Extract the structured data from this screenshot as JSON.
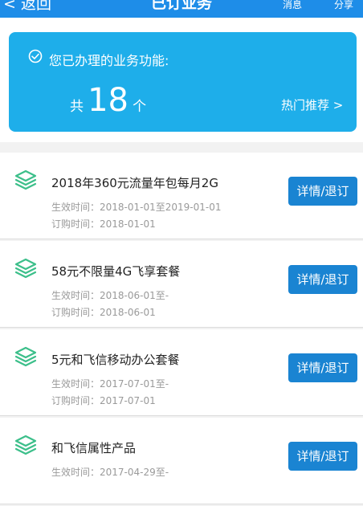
{
  "nav": {
    "back_label": "< 返回",
    "title": "已订业务",
    "message_label": "消息",
    "share_label": "分享"
  },
  "summary": {
    "heading": "您已办理的业务功能:",
    "count_prefix": "共",
    "count": "18",
    "count_unit": "个",
    "recommend_label": "热门推荐 >"
  },
  "colors": {
    "accent": "#1eaeea",
    "button": "#1a84d2",
    "icon_green": "#3cbf8a"
  },
  "services": [
    {
      "name": "2018年360元流量年包每月2G",
      "effective": "生效时间：2018-01-01至2019-01-01",
      "ordered": "订购时间：2018-01-01",
      "action_label": "详情/退订"
    },
    {
      "name": "58元不限量4G飞享套餐",
      "effective": "生效时间：2018-06-01至-",
      "ordered": "订购时间：2018-06-01",
      "action_label": "详情/退订"
    },
    {
      "name": "5元和飞信移动办公套餐",
      "effective": "生效时间：2017-07-01至-",
      "ordered": "订购时间：2017-07-01",
      "action_label": "详情/退订"
    },
    {
      "name": "和飞信属性产品",
      "effective": "生效时间：2017-04-29至-",
      "ordered": "",
      "action_label": "详情/退订"
    }
  ]
}
